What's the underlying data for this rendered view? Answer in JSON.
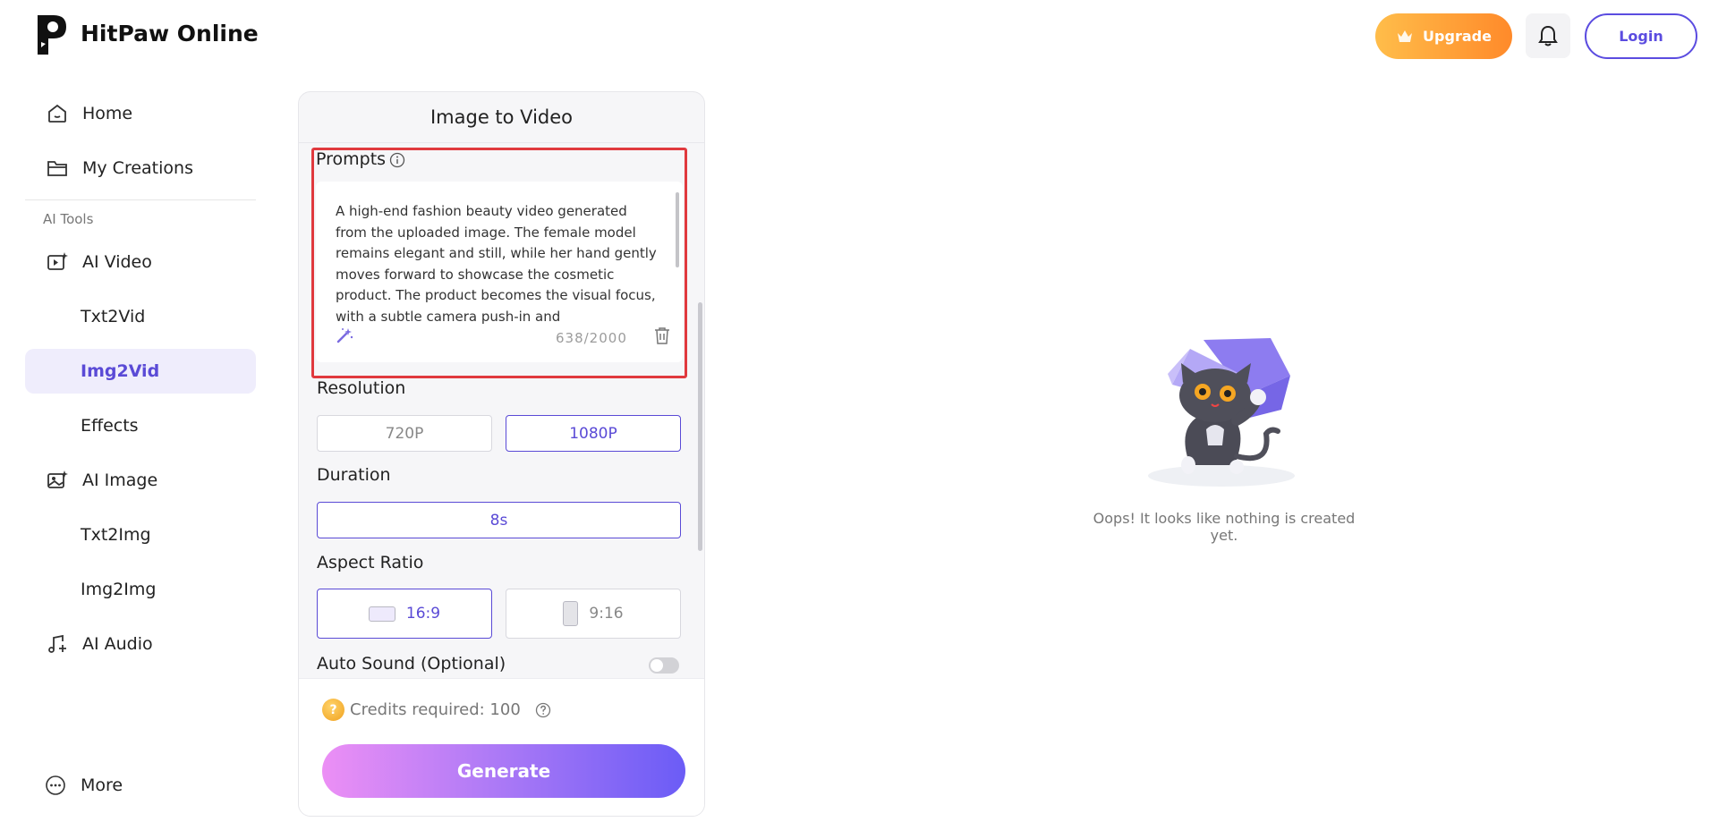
{
  "header": {
    "brand": "HitPaw Online",
    "upgrade_label": "Upgrade",
    "login_label": "Login",
    "icons": {
      "logo": "hitpaw-logo",
      "bell": "bell-icon",
      "crown": "crown-icon"
    }
  },
  "sidebar": {
    "home": "Home",
    "my_creations": "My Creations",
    "section_label": "AI Tools",
    "ai_video": "AI Video",
    "txt2vid": "Txt2Vid",
    "img2vid": "Img2Vid",
    "effects": "Effects",
    "ai_image": "AI Image",
    "txt2img": "Txt2Img",
    "img2img": "Img2Img",
    "ai_audio": "AI Audio",
    "more": "More"
  },
  "panel": {
    "title": "Image to Video",
    "prompts_label": "Prompts",
    "prompt_text": "A high-end fashion beauty video generated from the uploaded image. The female model remains elegant and still, while her hand gently moves forward to showcase the cosmetic product. The product becomes the visual focus, with a subtle camera push-in and",
    "counter": "638/2000",
    "resolution_label": "Resolution",
    "resolution_options": [
      "720P",
      "1080P"
    ],
    "resolution_selected": "1080P",
    "duration_label": "Duration",
    "duration_value": "8s",
    "aspect_label": "Aspect Ratio",
    "aspect_options": [
      "16:9",
      "9:16"
    ],
    "aspect_selected": "16:9",
    "auto_sound_label": "Auto Sound (Optional)",
    "auto_sound_on": false,
    "credits_label": "Credits required: 100",
    "generate_label": "Generate"
  },
  "empty_state": {
    "message": "Oops! It looks like nothing is created yet."
  },
  "colors": {
    "accent": "#5a4ad6",
    "highlight_box": "#e0393e",
    "upgrade_start": "#ffbd4a",
    "upgrade_end": "#ff8a2a"
  }
}
